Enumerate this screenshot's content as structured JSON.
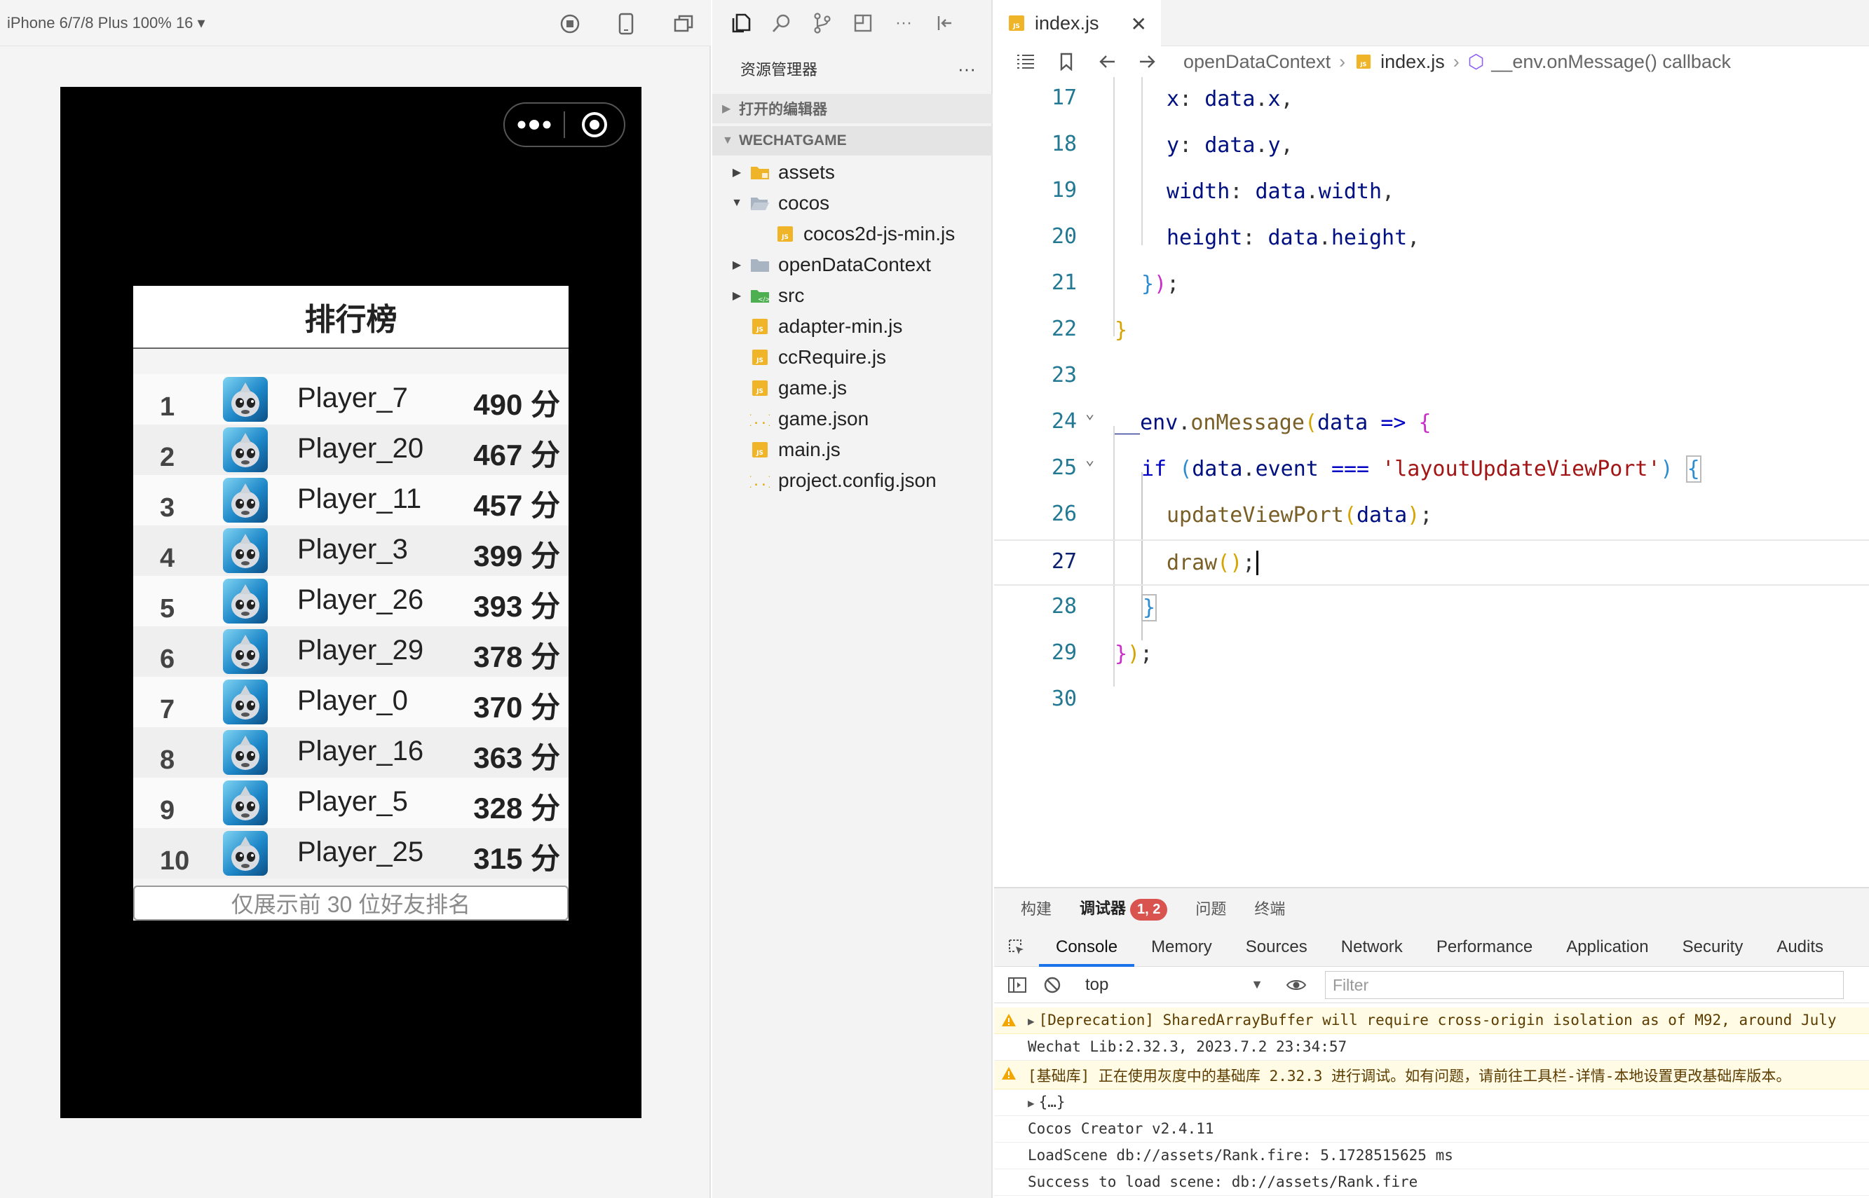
{
  "simulator": {
    "device_label": "iPhone 6/7/8 Plus 100% 16 ▾"
  },
  "leaderboard": {
    "title": "排行榜",
    "rows": [
      {
        "rank": "1",
        "name": "Player_7",
        "score": "490 分"
      },
      {
        "rank": "2",
        "name": "Player_20",
        "score": "467 分"
      },
      {
        "rank": "3",
        "name": "Player_11",
        "score": "457 分"
      },
      {
        "rank": "4",
        "name": "Player_3",
        "score": "399 分"
      },
      {
        "rank": "5",
        "name": "Player_26",
        "score": "393 分"
      },
      {
        "rank": "6",
        "name": "Player_29",
        "score": "378 分"
      },
      {
        "rank": "7",
        "name": "Player_0",
        "score": "370 分"
      },
      {
        "rank": "8",
        "name": "Player_16",
        "score": "363 分"
      },
      {
        "rank": "9",
        "name": "Player_5",
        "score": "328 分"
      },
      {
        "rank": "10",
        "name": "Player_25",
        "score": "315 分"
      }
    ],
    "footer": "仅展示前 30 位好友排名"
  },
  "explorer": {
    "title": "资源管理器",
    "more": "···",
    "open_editors": "打开的编辑器",
    "project": "WECHATGAME",
    "tree": [
      {
        "name": "assets",
        "type": "folder-assets",
        "twist": "▶"
      },
      {
        "name": "cocos",
        "type": "folder-open",
        "twist": "▼"
      },
      {
        "name": "cocos2d-js-min.js",
        "type": "js",
        "twist": ""
      },
      {
        "name": "openDataContext",
        "type": "folder",
        "twist": "▶"
      },
      {
        "name": "src",
        "type": "folder-src",
        "twist": "▶"
      },
      {
        "name": "adapter-min.js",
        "type": "js",
        "twist": ""
      },
      {
        "name": "ccRequire.js",
        "type": "js",
        "twist": ""
      },
      {
        "name": "game.js",
        "type": "js",
        "twist": ""
      },
      {
        "name": "game.json",
        "type": "json",
        "twist": ""
      },
      {
        "name": "main.js",
        "type": "js",
        "twist": ""
      },
      {
        "name": "project.config.json",
        "type": "json",
        "twist": ""
      }
    ]
  },
  "editor": {
    "tab": "index.js",
    "tab_close": "✕",
    "breadcrumb": [
      "openDataContext",
      "index.js",
      "__env.onMessage() callback"
    ],
    "lines": [
      "17",
      "18",
      "19",
      "20",
      "21",
      "22",
      "23",
      "24",
      "25",
      "26",
      "27",
      "28",
      "29",
      "30"
    ]
  },
  "debug": {
    "tabs": [
      "构建",
      "调试器",
      "问题",
      "终端"
    ],
    "badge": "1, 2",
    "devtools_tabs": [
      "Console",
      "Memory",
      "Sources",
      "Network",
      "Performance",
      "Application",
      "Security",
      "Audits"
    ],
    "context": "top",
    "filter_placeholder": "Filter",
    "console": [
      {
        "level": "warn",
        "text": "[Deprecation] SharedArrayBuffer will require cross-origin isolation as of M92, around July",
        "expandable": true
      },
      {
        "level": "log",
        "text": "Wechat Lib:2.32.3, 2023.7.2 23:34:57",
        "expandable": false
      },
      {
        "level": "warn",
        "text": "[基础库] 正在使用灰度中的基础库 2.32.3 进行调试。如有问题，请前往工具栏-详情-本地设置更改基础库版本。",
        "expandable": false
      },
      {
        "level": "log",
        "text": "{…}",
        "expandable": true
      },
      {
        "level": "log",
        "text": "Cocos Creator v2.4.11",
        "expandable": false
      },
      {
        "level": "log",
        "text": "LoadScene db://assets/Rank.fire: 5.1728515625 ms",
        "expandable": false
      },
      {
        "level": "log",
        "text": "Success to load scene: db://assets/Rank.fire",
        "expandable": false
      }
    ]
  },
  "colors": {
    "accent": "#1a73e8",
    "badge": "#d9534f",
    "js_icon": "#f0b429",
    "folder": "#a9b4c2",
    "src_folder": "#4caf50"
  }
}
